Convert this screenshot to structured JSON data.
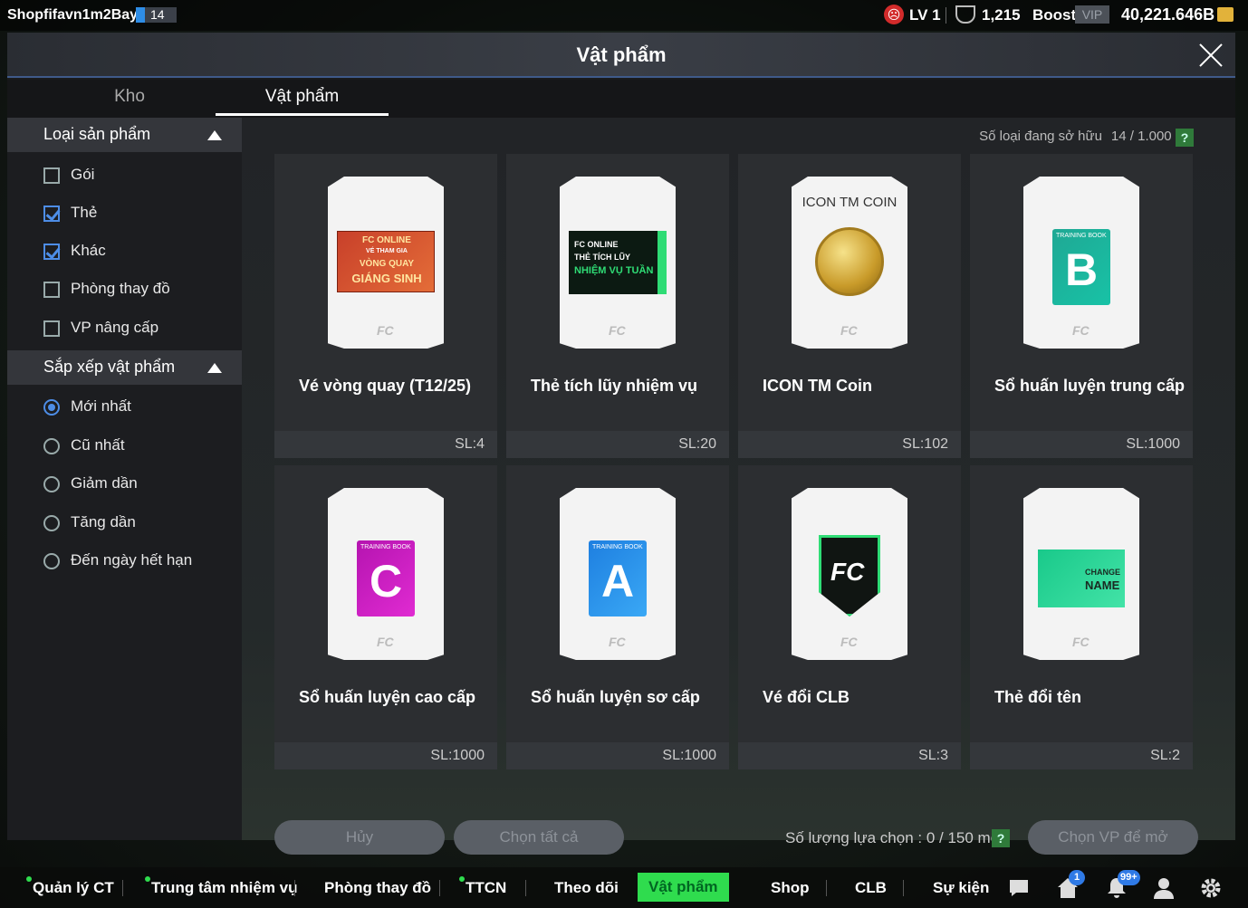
{
  "status": {
    "player_name": "Shopfifavn1m2Bay",
    "player_level_badge": "14",
    "lv": "LV 1",
    "fc_value": "1,215",
    "boost_label": "Boost",
    "vip_label": "VIP",
    "bp_value": "40,221.646B"
  },
  "modal": {
    "title": "Vật phẩm",
    "tabs": [
      {
        "label": "Kho"
      },
      {
        "label": "Vật phẩm"
      }
    ]
  },
  "sidebar": {
    "product_type": {
      "label": "Loại sản phẩm",
      "options": [
        {
          "label": "Gói",
          "checked": false
        },
        {
          "label": "Thẻ",
          "checked": true
        },
        {
          "label": "Khác",
          "checked": true
        },
        {
          "label": "Phòng thay đồ",
          "checked": false
        },
        {
          "label": "VP nâng cấp",
          "checked": false
        }
      ]
    },
    "sort": {
      "label": "Sắp xếp vật phẩm",
      "options": [
        {
          "label": "Mới nhất",
          "selected": true
        },
        {
          "label": "Cũ nhất",
          "selected": false
        },
        {
          "label": "Giảm dần",
          "selected": false
        },
        {
          "label": "Tăng dần",
          "selected": false
        },
        {
          "label": "Đến ngày hết hạn",
          "selected": false
        }
      ]
    }
  },
  "owned": {
    "label": "Số loại đang sở hữu",
    "value": "14 / 1.000 cái",
    "help": "?"
  },
  "items": [
    {
      "name": "Vé vòng quay (T12/25)",
      "qty": "SL:4",
      "icon": "spin-ticket-icon",
      "art": [
        "FC ONLINE",
        "VÉ THAM GIA",
        "VÒNG QUAY",
        "GIÁNG SINH"
      ]
    },
    {
      "name": "Thẻ tích lũy nhiệm vụ",
      "qty": "SL:20",
      "icon": "mission-card-icon",
      "art": [
        "FC ONLINE",
        "THẺ TÍCH LŨY",
        "NHIỆM VỤ TUẦN"
      ]
    },
    {
      "name": "ICON TM Coin",
      "qty": "SL:102",
      "icon": "icon-tm-coin-icon",
      "art": [
        "ICON TM COIN"
      ]
    },
    {
      "name": "Sổ huấn luyện trung cấp",
      "qty": "SL:1000",
      "icon": "training-book-b-icon",
      "art": [
        "TRAINING BOOK",
        "B"
      ]
    },
    {
      "name": "Sổ huấn luyện cao cấp",
      "qty": "SL:1000",
      "icon": "training-book-c-icon",
      "art": [
        "TRAINING BOOK",
        "C"
      ]
    },
    {
      "name": "Sổ huấn luyện sơ cấp",
      "qty": "SL:1000",
      "icon": "training-book-a-icon",
      "art": [
        "TRAINING BOOK",
        "A"
      ]
    },
    {
      "name": "Vé đổi CLB",
      "qty": "SL:3",
      "icon": "club-change-ticket-icon",
      "art": [
        "FC"
      ]
    },
    {
      "name": "Thẻ đổi tên",
      "qty": "SL:2",
      "icon": "change-name-card-icon",
      "art": [
        "CHANGE",
        "NAME"
      ]
    }
  ],
  "actions": {
    "cancel": "Hủy",
    "select_all": "Chọn tất cả",
    "selection": "Số lượng lựa chọn : 0 / 150 món",
    "help": "?",
    "open": "Chọn VP để mở"
  },
  "nav": {
    "items": [
      {
        "label": "Quản lý CT",
        "dot": true
      },
      {
        "label": "Trung tâm nhiệm vụ",
        "dot": true
      },
      {
        "label": "Phòng thay đồ",
        "dot": false
      },
      {
        "label": "TTCN",
        "dot": true
      },
      {
        "label": "Theo dõi",
        "dot": false
      },
      {
        "label": "Vật phẩm",
        "dot": false,
        "active": true
      },
      {
        "label": "Shop",
        "dot": false
      },
      {
        "label": "CLB",
        "dot": false
      },
      {
        "label": "Sự kiện",
        "dot": false
      }
    ],
    "home_badge": "1",
    "notif_badge": "99+"
  },
  "colors": {
    "accent_green": "#2fdc4e",
    "check_blue": "#4d8de6"
  }
}
